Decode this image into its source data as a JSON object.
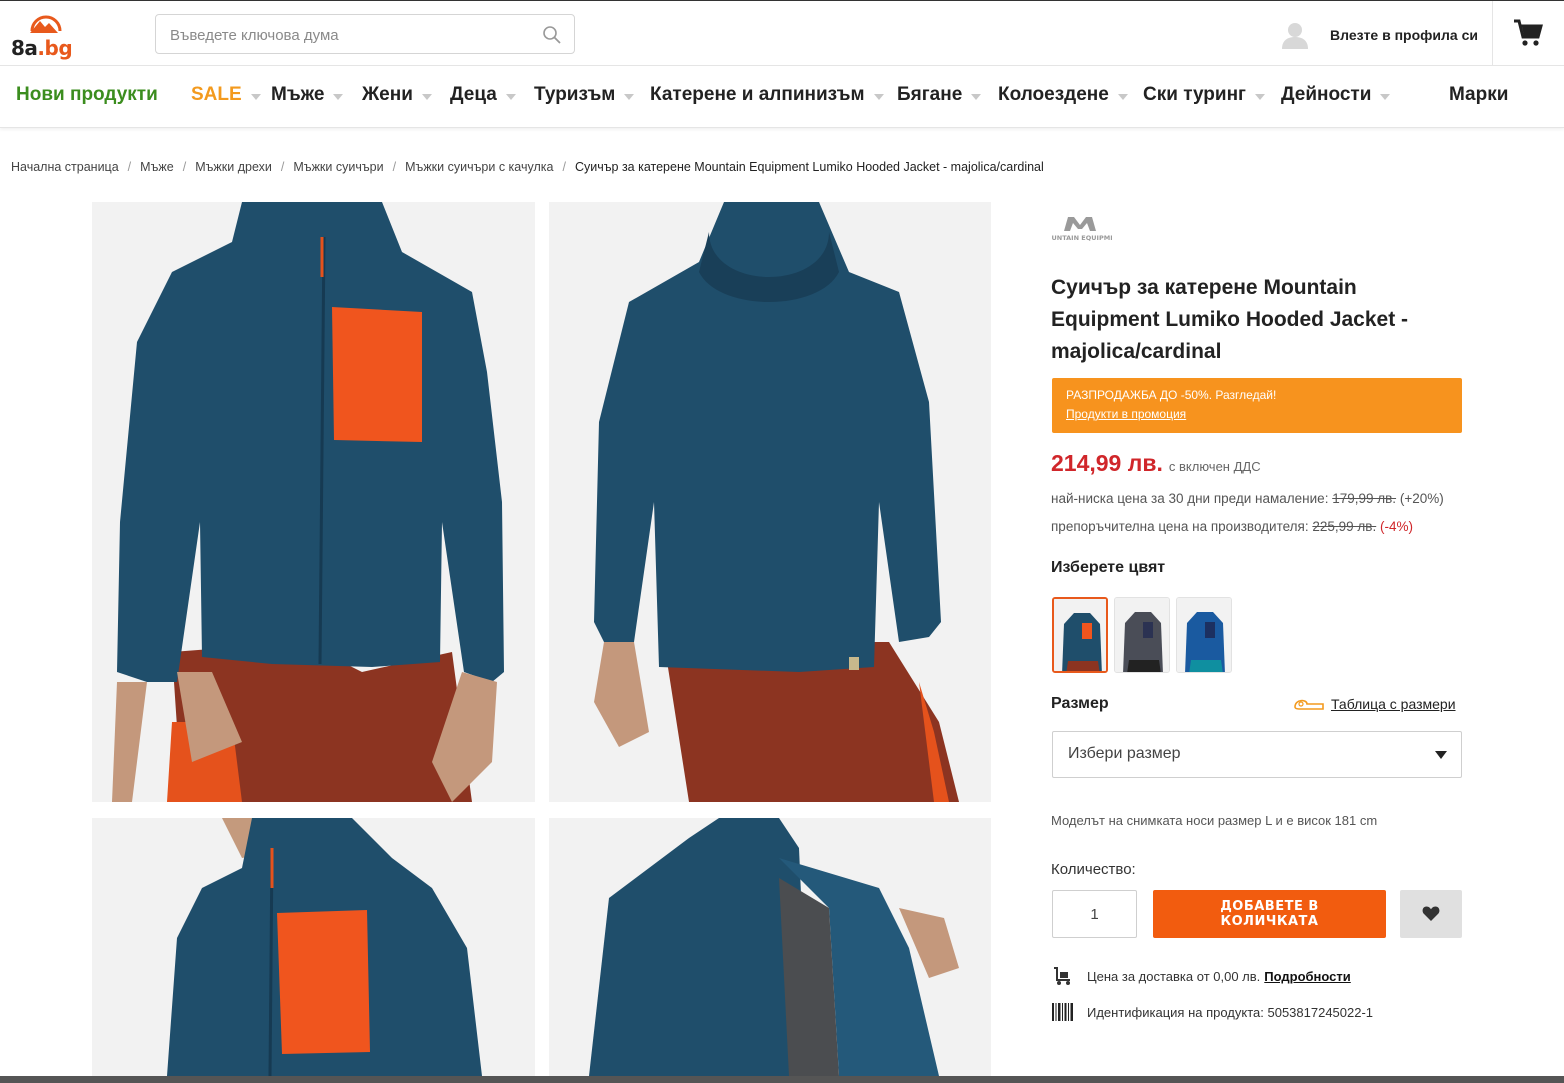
{
  "header": {
    "logo_text_main": "8a",
    "logo_text_tld": ".bg",
    "search_placeholder": "Въведете ключова дума",
    "account_label": "Влезте в профила си"
  },
  "nav": {
    "items": [
      {
        "label": "Нови продукти"
      },
      {
        "label": "SALE"
      },
      {
        "label": "Мъже"
      },
      {
        "label": "Жени"
      },
      {
        "label": "Деца"
      },
      {
        "label": "Туризъм"
      },
      {
        "label": "Катерене и алпинизъм"
      },
      {
        "label": "Бягане"
      },
      {
        "label": "Колоездене"
      },
      {
        "label": "Ски туринг"
      },
      {
        "label": "Дейности"
      },
      {
        "label": "Марки"
      }
    ],
    "colors": {
      "new": "#3b8d1e",
      "sale": "#f39a1e"
    }
  },
  "breadcrumb": [
    "Начална страница",
    "Мъже",
    "Мъжки дрехи",
    "Мъжки суичъри",
    "Мъжки суичъри с качулка",
    "Суичър за катерене Mountain Equipment Lumiko Hooded Jacket - majolica/cardinal"
  ],
  "product": {
    "brand_logo_text": "MOUNTAIN EQUIPMENT",
    "title": "Суичър за катерене Mountain Equipment Lumiko Hooded Jacket - majolica/cardinal",
    "promo_line1": "РАЗПРОДАЖБА ДО -50%. Разгледай!",
    "promo_line2": "Продукти в промоция",
    "price": "214,99 лв.",
    "vat_note": "с включен ДДС",
    "lowest_label": "най-ниска цена за 30 дни преди намаление:",
    "lowest_price": "179,99 лв.",
    "lowest_pct": "(+20%)",
    "rrp_label": "препоръчителна цена на производителя:",
    "rrp_price": "225,99 лв.",
    "rrp_pct": "(-4%)",
    "color_label": "Изберете цвят",
    "size_label": "Размер",
    "size_table_link": "Таблица с размери",
    "size_select_value": "Избери размер",
    "model_note": "Моделът на снимката носи размер L и е висок 181 cm",
    "qty_label": "Количество:",
    "qty_value": "1",
    "add_to_cart_line1": "ДОБАВЕТЕ В",
    "add_to_cart_line2": "КОЛИЧКАТА",
    "shipping_text": "Цена за доставка от 0,00 лв.",
    "shipping_link": "Подробности",
    "product_id_text": "Идентификация на продукта: 5053817245022-1"
  },
  "colors": {
    "accent_orange": "#f25c0f",
    "promo_orange": "#f7931e",
    "price_red": "#d0262a",
    "jacket_blue": "#1f4e6b",
    "pocket_orange": "#f0551e",
    "pants_rust": "#8c3421"
  }
}
